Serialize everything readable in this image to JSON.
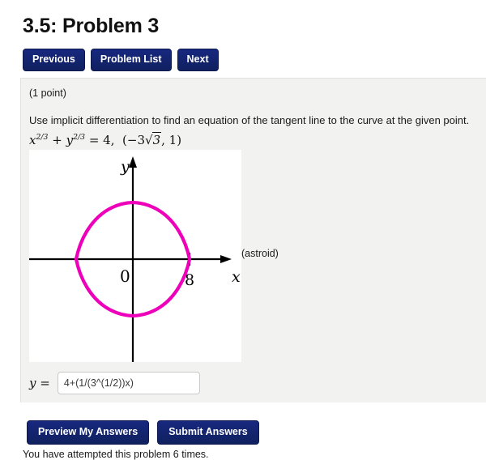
{
  "page": {
    "title": "3.5: Problem 3"
  },
  "nav": {
    "previous_label": "Previous",
    "problem_list_label": "Problem List",
    "next_label": "Next"
  },
  "problem": {
    "points_label": "(1 point)",
    "prompt": "Use implicit differentiation to find an equation of the tangent line to the curve at the given point.",
    "equation_plain": "x^(2/3) + y^(2/3) = 4,  (-3√3, 1)",
    "equation_parts": {
      "x_var": "x",
      "x_exp": "2/3",
      "plus": "+",
      "y_var": "y",
      "y_exp": "2/3",
      "equals": "=",
      "rhs": "4",
      "comma": ",",
      "point_open": "(",
      "point_neg3": "−3",
      "radical": "√",
      "radicand": "3",
      "point_comma": ", 1",
      "point_close": ")"
    },
    "graph_caption": "(astroid)"
  },
  "chart_data": {
    "type": "line",
    "title": "",
    "curve_name": "astroid",
    "equation": "x^(2/3) + y^(2/3) = 4",
    "parametric": "x = 8 cos^3(t), y = 8 sin^3(t)",
    "xlabel": "x",
    "ylabel": "y",
    "origin_label": "0",
    "x_tick_labels": [
      "8"
    ],
    "x_tick_values": [
      8
    ],
    "y_tick_labels": [],
    "xlim": [
      -11.5,
      11.5
    ],
    "ylim": [
      -11.5,
      11.5
    ],
    "grid": false,
    "legend": false,
    "curve_color": "#ee00bb",
    "axis_color": "#000000",
    "cusps": [
      [
        8,
        0
      ],
      [
        0,
        8
      ],
      [
        -8,
        0
      ],
      [
        0,
        -8
      ]
    ]
  },
  "answer": {
    "label_y": "y",
    "label_equals": "=",
    "value": "4+(1/(3^(1/2))x)",
    "placeholder": ""
  },
  "footer": {
    "preview_label": "Preview My Answers",
    "submit_label": "Submit Answers",
    "attempts_text": "You have attempted this problem 6 times."
  },
  "colors": {
    "button_navy": "#16277e",
    "panel_gray": "#f2f2f0",
    "curve_magenta": "#ee00bb"
  }
}
